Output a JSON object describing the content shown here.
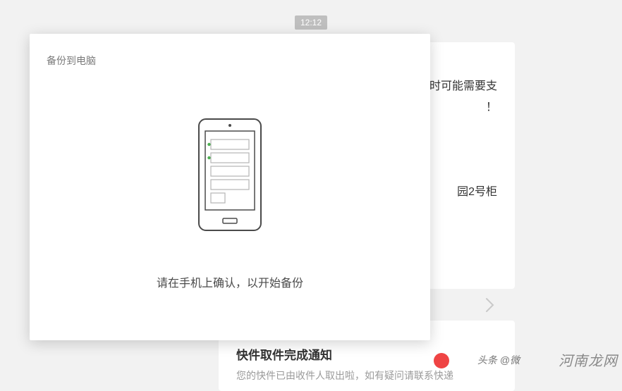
{
  "time": "12:12",
  "bg": {
    "line1": "时可能需要支",
    "line2": "！",
    "line3": "园2号柜",
    "title2": "快件取件完成通知",
    "sub2": "您的快件已由收件人取出啦，如有疑问请联系快递"
  },
  "modal": {
    "title": "备份到电脑",
    "instruction": "请在手机上确认，以开始备份"
  },
  "watermark": {
    "attribution": "头条 @微",
    "site": "河南龙网"
  }
}
